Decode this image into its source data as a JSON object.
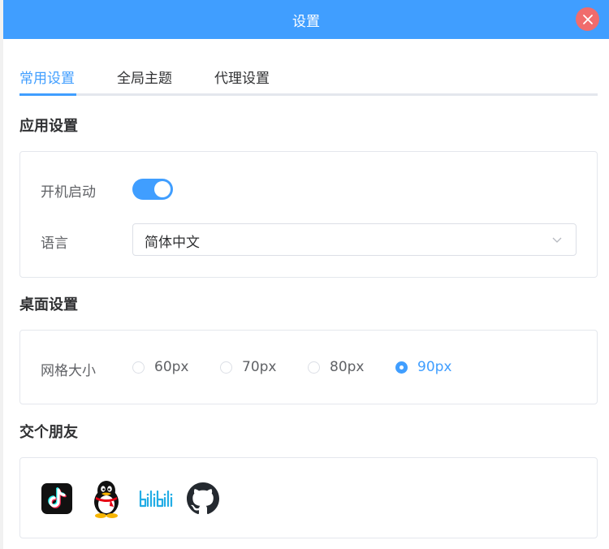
{
  "window": {
    "title": "设置"
  },
  "tabs": [
    {
      "label": "常用设置",
      "active": true
    },
    {
      "label": "全局主题",
      "active": false
    },
    {
      "label": "代理设置",
      "active": false
    }
  ],
  "app_settings": {
    "title": "应用设置",
    "autostart": {
      "label": "开机启动",
      "enabled": true
    },
    "language": {
      "label": "语言",
      "value": "简体中文"
    }
  },
  "desktop_settings": {
    "title": "桌面设置",
    "grid_size": {
      "label": "网格大小",
      "options": [
        "60px",
        "70px",
        "80px",
        "90px"
      ],
      "selected": "90px"
    }
  },
  "friends": {
    "title": "交个朋友",
    "links": [
      "tiktok-icon",
      "qq-penguin-icon",
      "bilibili-icon",
      "github-icon"
    ]
  },
  "colors": {
    "accent": "#409eff",
    "close": "#f06c6c",
    "border": "#e4e7ed"
  }
}
